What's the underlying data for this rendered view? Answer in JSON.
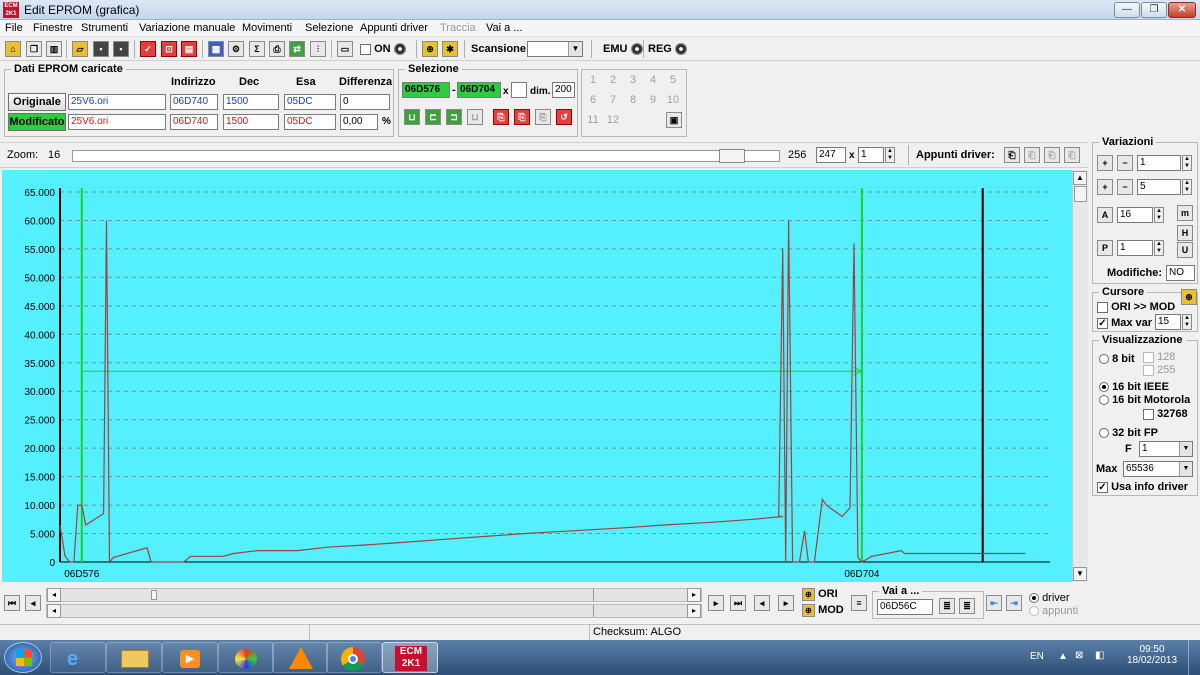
{
  "window": {
    "title": "Edit EPROM (grafica)",
    "logo_text": "ECM 2K1",
    "min": "—",
    "max": "❐",
    "close": "✕"
  },
  "menu": [
    "File",
    "Finestre",
    "Strumenti",
    "Variazione manuale",
    "Movimenti",
    "Selezione",
    "Appunti driver",
    "Traccia",
    "Vai a ..."
  ],
  "menu_disabled_index": 7,
  "toolbar": {
    "on_label": "ON",
    "scansione_label": "Scansione",
    "scansione_value": "",
    "emu_label": "EMU",
    "reg_label": "REG"
  },
  "dati": {
    "title": "Dati EPROM caricate",
    "headers": {
      "indirizzo": "Indirizzo",
      "dec": "Dec",
      "esa": "Esa",
      "differenza": "Differenza"
    },
    "originale": {
      "label": "Originale",
      "file": "25V6.ori",
      "indirizzo": "06D740",
      "dec": "1500",
      "esa": "05DC",
      "diff": "0"
    },
    "modificato": {
      "label": "Modificato",
      "file": "25V6.ori",
      "indirizzo": "06D740",
      "dec": "1500",
      "esa": "05DC",
      "diff": "0,00",
      "pct": "%"
    }
  },
  "selezione": {
    "title": "Selezione",
    "from": "06D576",
    "sep": "-",
    "to": "06D704",
    "x_label": "x",
    "dim_label": "dim.",
    "dim_value": "200"
  },
  "numgrid": [
    "1",
    "2",
    "3",
    "4",
    "5",
    "6",
    "7",
    "8",
    "9",
    "10",
    "11",
    "12"
  ],
  "zoom": {
    "label": "Zoom:",
    "value": "16",
    "max": "256",
    "field": "247",
    "x_label": "x",
    "mult": "1",
    "appunti_label": "Appunti driver:",
    "slider_fraction": 0.95
  },
  "chart_data": {
    "type": "line",
    "ylim": [
      0,
      65000
    ],
    "y_ticks": [
      "0",
      "5.000",
      "10.000",
      "15.000",
      "20.000",
      "25.000",
      "30.000",
      "35.000",
      "40.000",
      "45.000",
      "50.000",
      "55.000",
      "60.000",
      "65.000"
    ],
    "y_tick_values": [
      0,
      5000,
      10000,
      15000,
      20000,
      25000,
      30000,
      35000,
      40000,
      45000,
      50000,
      55000,
      60000,
      65000
    ],
    "x_range": [
      0,
      100
    ],
    "x_labels": [
      {
        "text": "06D576",
        "x": 2.2
      },
      {
        "text": "06D704",
        "x": 81
      }
    ],
    "cursor_lines_x": [
      2.2,
      81
    ],
    "end_line_x": 93.2,
    "cursor_h_value": 33500,
    "series": [
      {
        "points": [
          [
            0,
            6500
          ],
          [
            0.5,
            1000
          ],
          [
            1,
            0
          ],
          [
            1.4,
            0
          ],
          [
            1.8,
            10000
          ],
          [
            2.2,
            10000
          ],
          [
            2.6,
            6500
          ],
          [
            4.4,
            8500
          ],
          [
            4.7,
            60000
          ],
          [
            5.0,
            0
          ],
          [
            5.4,
            800
          ],
          [
            8.8,
            2500
          ],
          [
            9.2,
            0
          ],
          [
            12.5,
            0
          ],
          [
            13.2,
            1000
          ],
          [
            16.5,
            1000
          ],
          [
            17.5,
            1500
          ],
          [
            20,
            2000
          ],
          [
            24,
            2000
          ],
          [
            27,
            2600
          ],
          [
            31,
            3000
          ],
          [
            35,
            3500
          ],
          [
            39,
            4000
          ],
          [
            43,
            4500
          ],
          [
            47,
            5000
          ],
          [
            52,
            5500
          ],
          [
            57,
            6000
          ],
          [
            61,
            6500
          ],
          [
            66,
            7000
          ],
          [
            70,
            7500
          ],
          [
            73,
            8000
          ],
          [
            72.6,
            8000
          ],
          [
            73,
            55000
          ],
          [
            73.3,
            0
          ],
          [
            73.6,
            60000
          ],
          [
            74,
            0
          ],
          [
            74.7,
            0
          ],
          [
            75.2,
            5500
          ],
          [
            75.6,
            0
          ],
          [
            76.2,
            0
          ],
          [
            77,
            11000
          ],
          [
            77.4,
            10000
          ],
          [
            79,
            8000
          ],
          [
            79.8,
            9500
          ],
          [
            80.2,
            56000
          ],
          [
            80.6,
            800
          ],
          [
            81,
            0
          ],
          [
            82,
            1000
          ],
          [
            83.5,
            1500
          ],
          [
            85,
            2000
          ],
          [
            85.3,
            1500
          ],
          [
            97.5,
            1500
          ]
        ],
        "color": "#a04040"
      }
    ]
  },
  "right": {
    "variazioni_title": "Variazioni",
    "v1": "1",
    "v2": "5",
    "v3": "16",
    "v4": "1",
    "modifiche_label": "Modifiche:",
    "modifiche_value": "NO",
    "cursore_title": "Cursore",
    "ori_mod_label": "ORI >> MOD",
    "max_var_label": "Max var",
    "max_var_value": "15",
    "vis_title": "Visualizzazione",
    "bit8": "8 bit",
    "v128": "128",
    "v255": "255",
    "bit16ieee": "16 bit IEEE",
    "bit16mot": "16 bit Motorola",
    "v32768": "32768",
    "bit32": "32 bit FP",
    "f_label": "F",
    "f_value": "1",
    "max_label": "Max",
    "max_value": "65536",
    "usa_info": "Usa info driver"
  },
  "bottom": {
    "ori_label": "ORI",
    "mod_label": "MOD",
    "vai_title": "Vai a ...",
    "vai_value": "06D56C",
    "driver_label": "driver",
    "appunti_label": "appunti"
  },
  "status": {
    "checksum": "Checksum: ALGO"
  },
  "taskbar": {
    "lang": "EN",
    "time": "09:50",
    "date": "18/02/2013",
    "ecm_text": "ECM 2K1"
  }
}
